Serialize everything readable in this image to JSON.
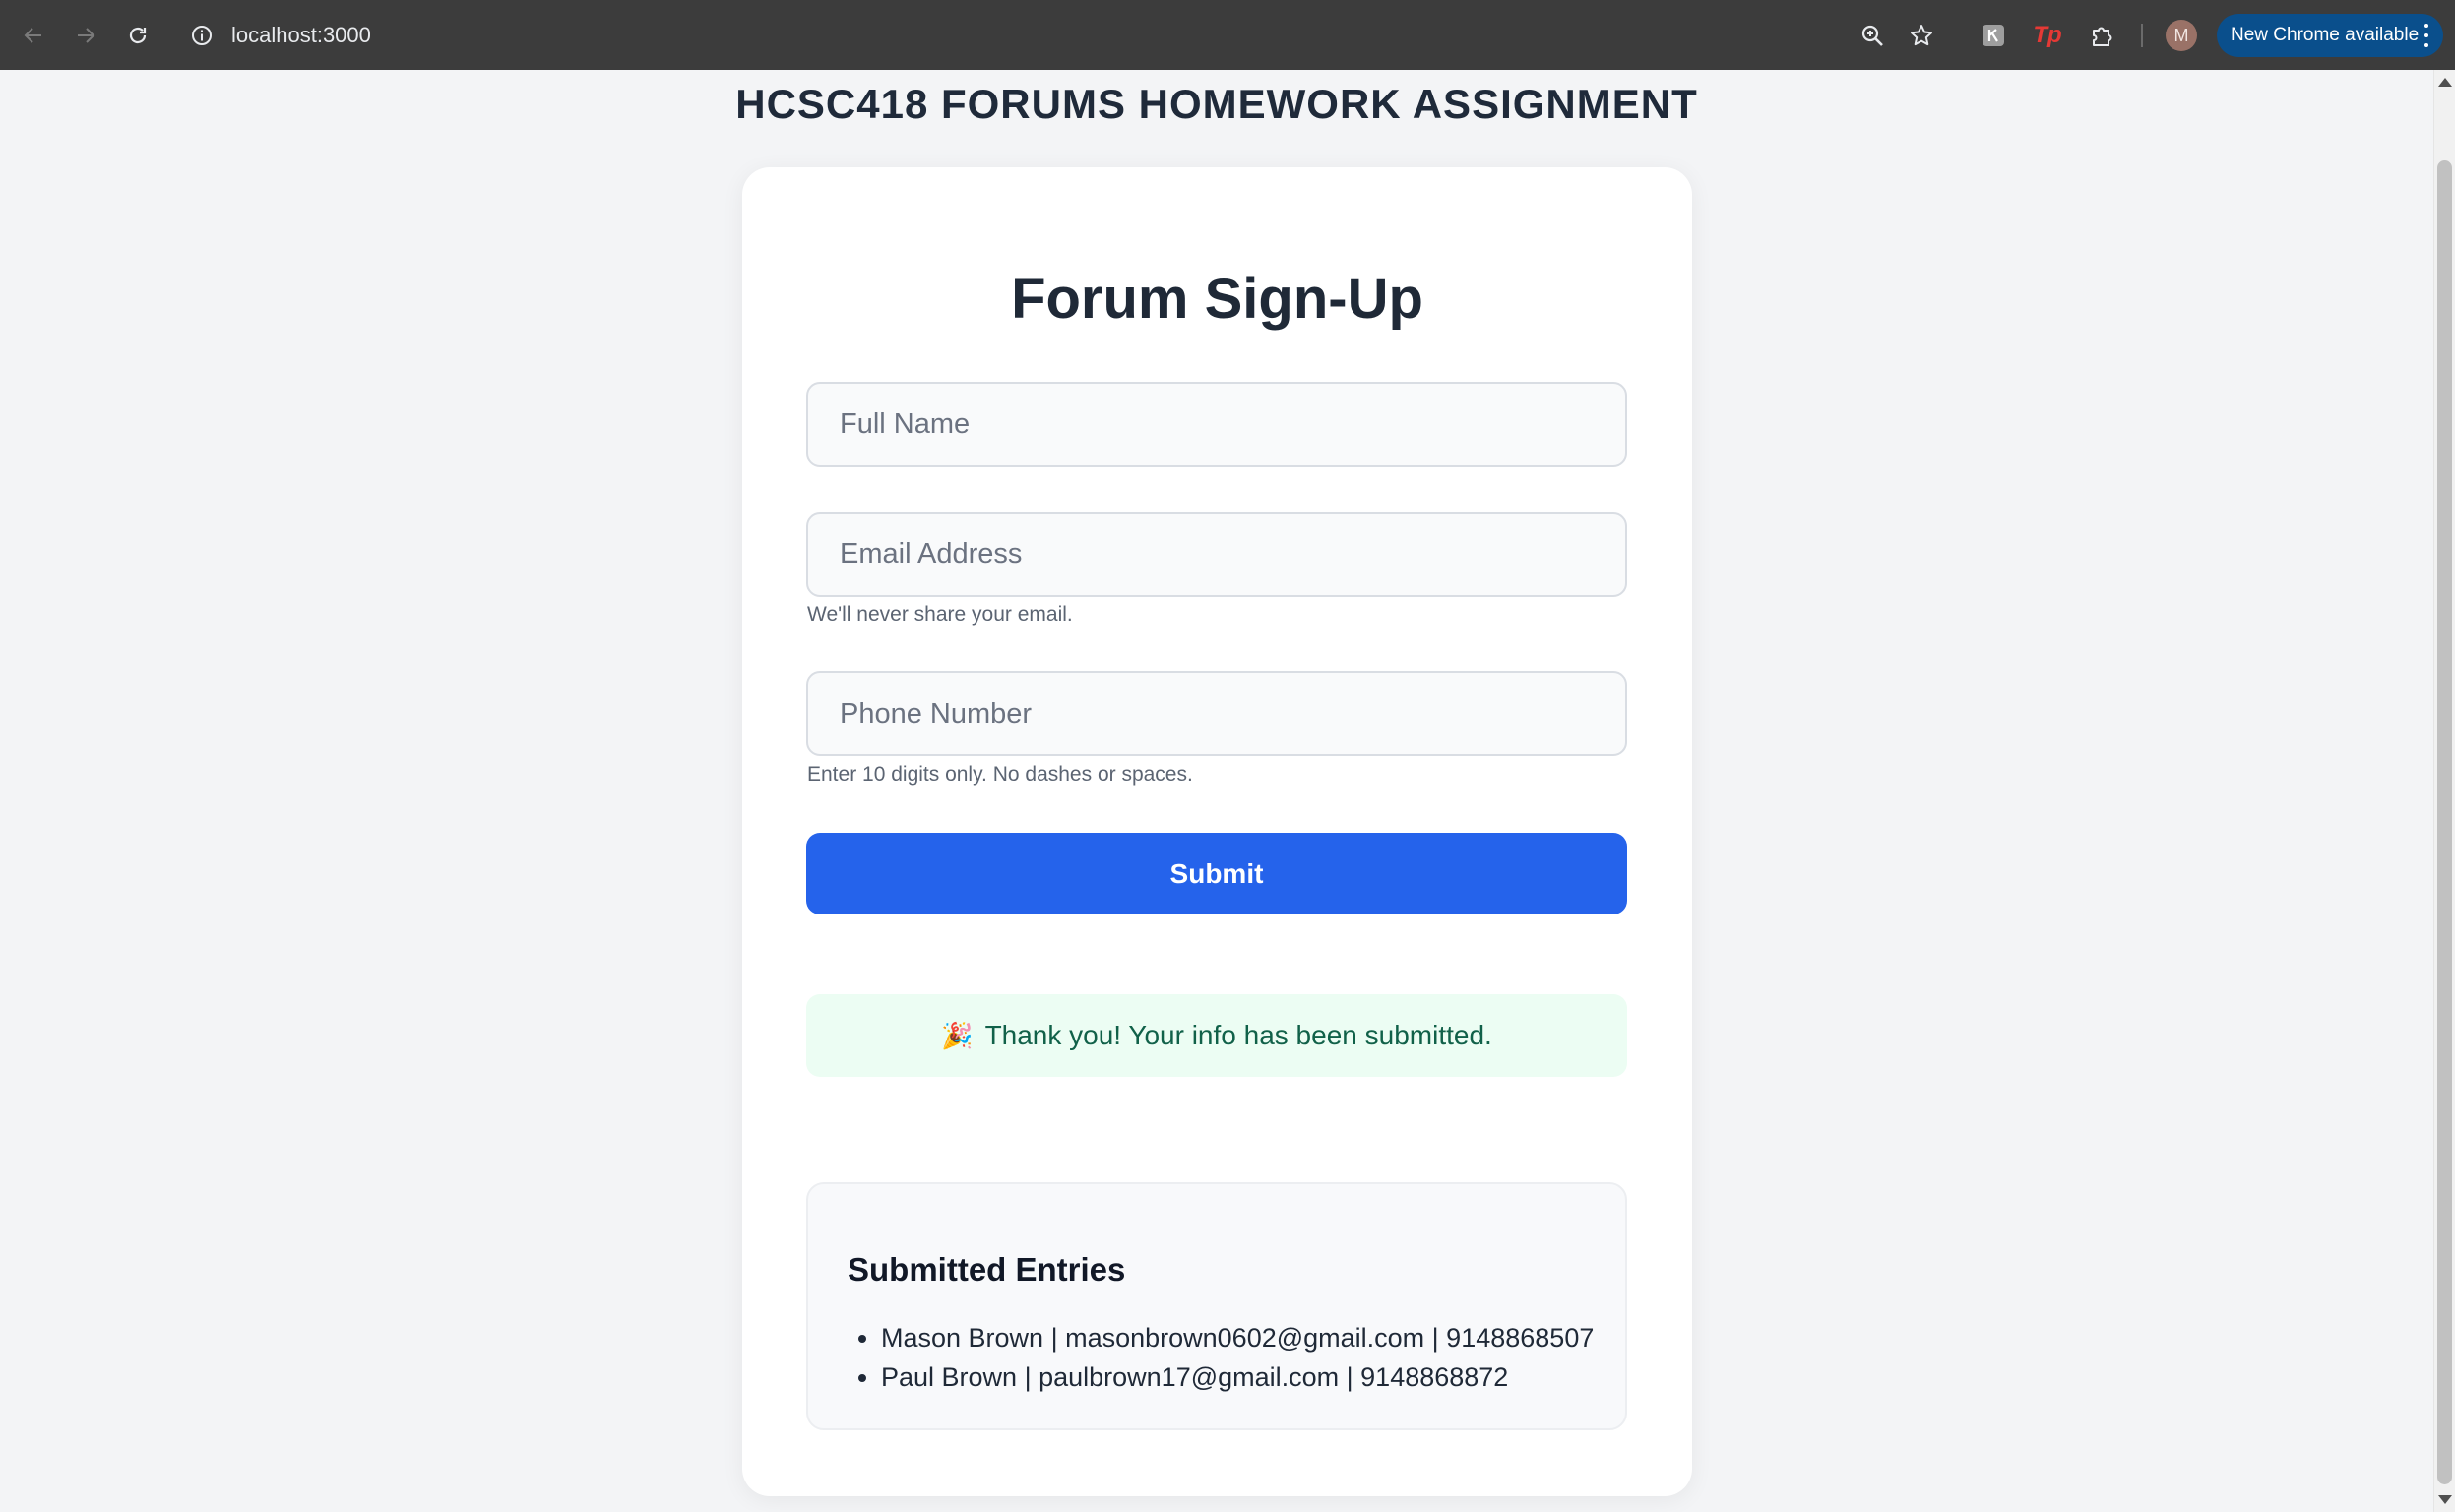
{
  "browser": {
    "url": "localhost:3000",
    "new_chrome_label": "New Chrome available",
    "avatar_initial": "M",
    "extension_tp_label": "Tp"
  },
  "page": {
    "title": "HCSC418 FORUMS HOMEWORK ASSIGNMENT"
  },
  "form": {
    "title": "Forum Sign-Up",
    "full_name": {
      "placeholder": "Full Name",
      "value": ""
    },
    "email": {
      "placeholder": "Email Address",
      "value": "",
      "helper": "We'll never share your email."
    },
    "phone": {
      "placeholder": "Phone Number",
      "value": "",
      "helper": "Enter 10 digits only. No dashes or spaces."
    },
    "submit_label": "Submit",
    "success_message": "Thank you! Your info has been submitted.",
    "success_emoji": "🎉"
  },
  "entries": {
    "title": "Submitted Entries",
    "items": [
      "Mason Brown | masonbrown0602@gmail.com | 9148868507",
      "Paul Brown | paulbrown17@gmail.com | 9148868872"
    ]
  },
  "colors": {
    "chrome_bg": "#3c3c3c",
    "page_bg": "#f3f4f6",
    "accent": "#2563eb",
    "success_bg": "#ecfdf3",
    "success_text": "#116149"
  }
}
